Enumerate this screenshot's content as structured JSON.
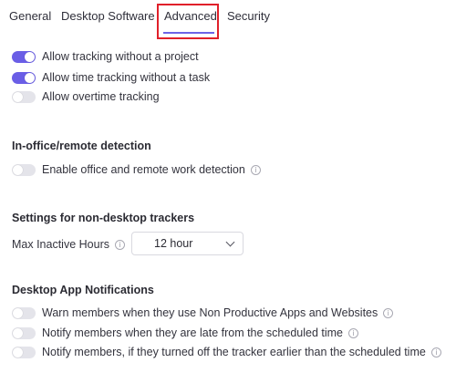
{
  "tabs": {
    "general": "General",
    "desktop_software": "Desktop Software",
    "advanced": "Advanced",
    "security": "Security",
    "active": "advanced"
  },
  "tracking": {
    "allow_without_project": {
      "label": "Allow tracking without a project",
      "on": true
    },
    "allow_without_task": {
      "label": "Allow time tracking without a task",
      "on": true
    },
    "allow_overtime": {
      "label": "Allow overtime tracking",
      "on": false
    }
  },
  "office_remote": {
    "title": "In-office/remote detection",
    "enable_detection": {
      "label": "Enable office and remote work detection",
      "on": false
    }
  },
  "non_desktop": {
    "title": "Settings for non-desktop trackers",
    "max_inactive_label": "Max Inactive Hours",
    "max_inactive_value": "12 hour"
  },
  "notifications": {
    "title": "Desktop App Notifications",
    "warn_non_productive": {
      "label": "Warn members when they use Non Productive Apps and Websites",
      "on": false
    },
    "notify_late": {
      "label": "Notify members when they are late from the scheduled time",
      "on": false
    },
    "notify_turned_off_early": {
      "label": "Notify members, if they turned off the tracker earlier than the scheduled time",
      "on": false
    }
  },
  "colors": {
    "accent": "#6a5ee6",
    "highlight_border": "#e0202a",
    "toggle_off": "#e4e4ea"
  },
  "icons": {
    "info": "info-icon",
    "dropdown": "chevron-down-icon"
  }
}
